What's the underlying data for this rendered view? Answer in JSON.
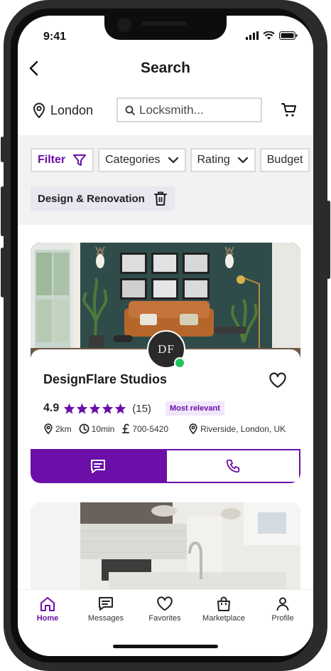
{
  "status": {
    "time": "9:41"
  },
  "header": {
    "title": "Search"
  },
  "location": {
    "city": "London"
  },
  "search": {
    "placeholder": "Locksmith..."
  },
  "filters": {
    "chips": [
      "Filter",
      "Categories",
      "Rating",
      "Budget"
    ],
    "active_tag": "Design & Renovation"
  },
  "listing": {
    "name": "DesignFlare Studios",
    "logo_text": "DF",
    "rating": "4.9",
    "stars": 5,
    "reviews": "(15)",
    "badge": "Most relevant",
    "distance": "2km",
    "time": "10min",
    "price": "700-5420",
    "address": "Riverside, London, UK"
  },
  "tabs": [
    {
      "label": "Home",
      "icon": "home-icon",
      "active": true
    },
    {
      "label": "Messages",
      "icon": "messages-icon"
    },
    {
      "label": "Favorites",
      "icon": "heart-icon"
    },
    {
      "label": "Marketplace",
      "icon": "bag-icon"
    },
    {
      "label": "Profile",
      "icon": "user-icon"
    }
  ],
  "colors": {
    "accent": "#6b0fa8",
    "online": "#22c55e"
  }
}
